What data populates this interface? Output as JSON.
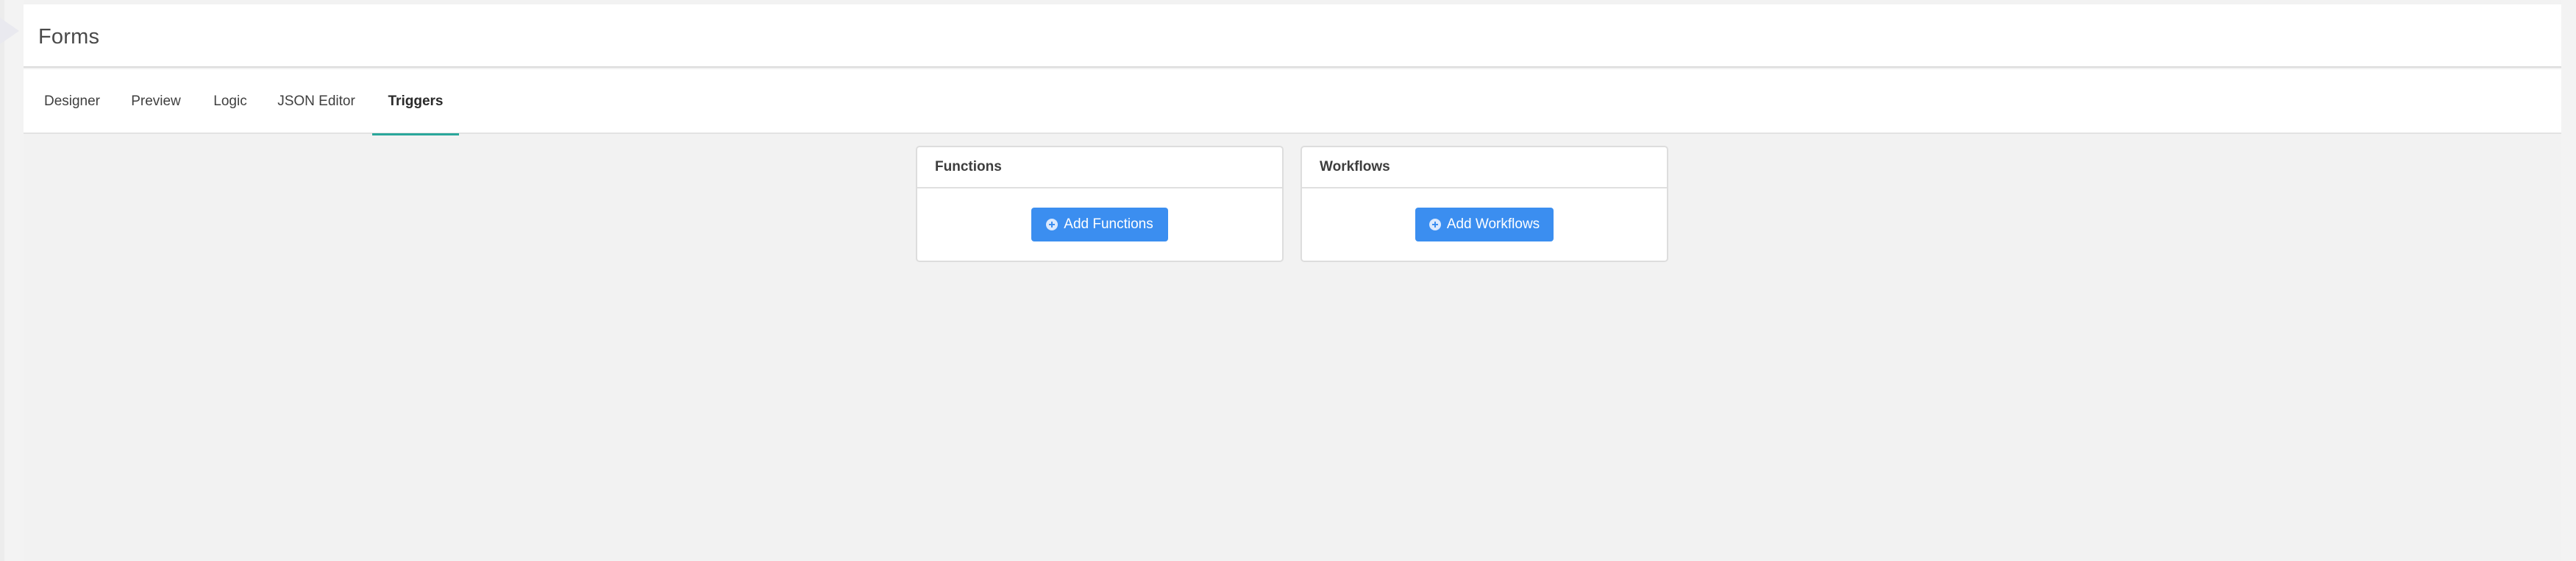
{
  "header": {
    "title": "Forms"
  },
  "tabs": [
    {
      "label": "Designer",
      "active": false
    },
    {
      "label": "Preview",
      "active": false
    },
    {
      "label": "Logic",
      "active": false
    },
    {
      "label": "JSON Editor",
      "active": false
    },
    {
      "label": "Triggers",
      "active": true
    }
  ],
  "cards": {
    "functions": {
      "title": "Functions",
      "button_label": "Add Functions",
      "button_icon": "plus-circle-icon"
    },
    "workflows": {
      "title": "Workflows",
      "button_label": "Add Workflows",
      "button_icon": "plus-circle-icon"
    }
  },
  "colors": {
    "accent_tab": "#2aa79b",
    "primary_button": "#3b8ef0",
    "background": "#f2f2f2"
  }
}
